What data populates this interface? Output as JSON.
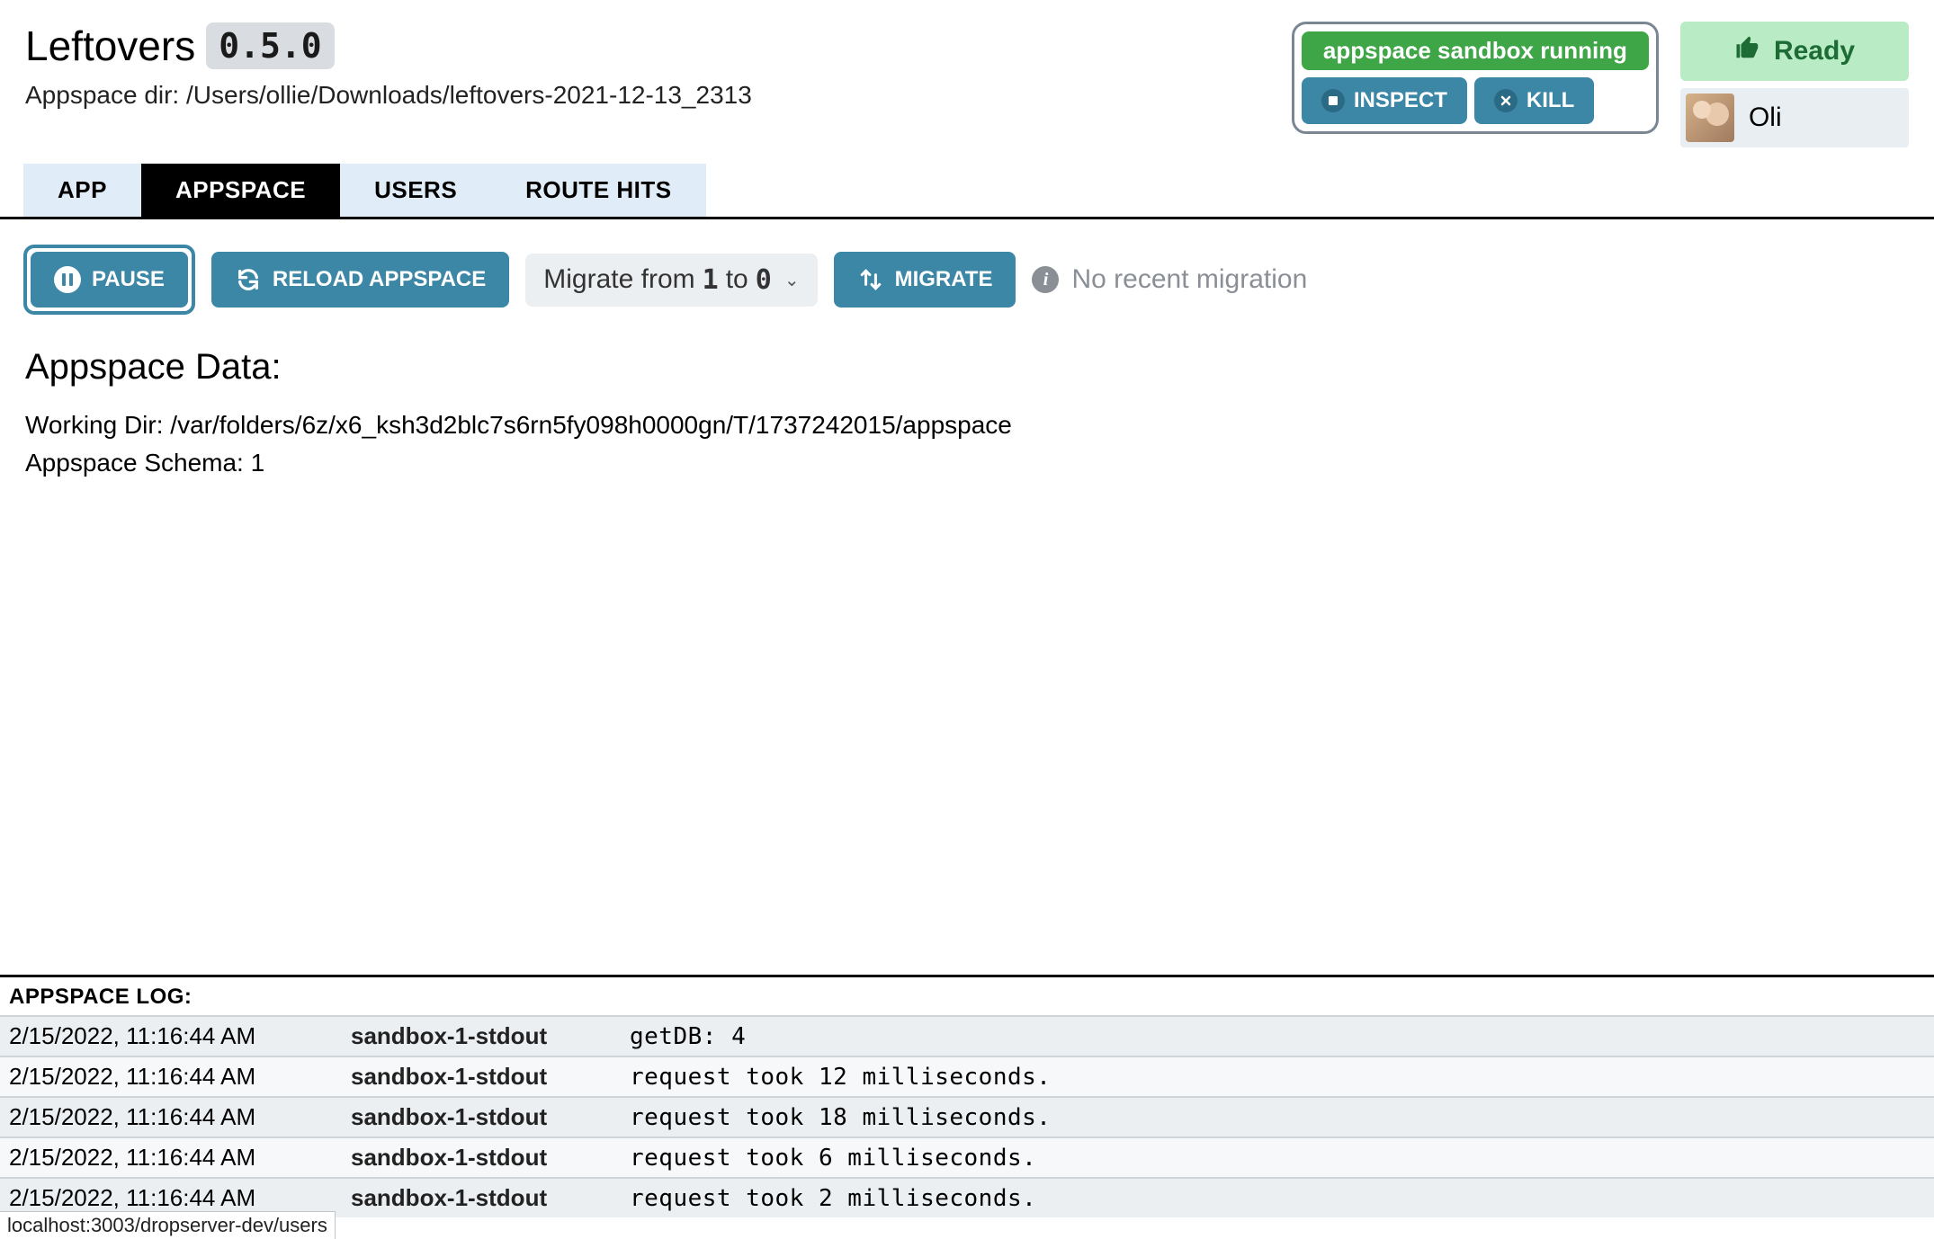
{
  "header": {
    "app_name": "Leftovers",
    "version": "0.5.0",
    "subtitle_label": "Appspace dir:",
    "subtitle_path": "/Users/ollie/Downloads/leftovers-2021-12-13_2313"
  },
  "sandbox": {
    "status": "appspace sandbox running",
    "inspect_label": "INSPECT",
    "kill_label": "KILL"
  },
  "ready": {
    "label": "Ready"
  },
  "user": {
    "name": "Oli"
  },
  "tabs": [
    {
      "id": "app",
      "label": "APP",
      "active": false
    },
    {
      "id": "appspace",
      "label": "APPSPACE",
      "active": true
    },
    {
      "id": "users",
      "label": "USERS",
      "active": false
    },
    {
      "id": "routehits",
      "label": "ROUTE HITS",
      "active": false
    }
  ],
  "toolbar": {
    "pause_label": "PAUSE",
    "reload_label": "RELOAD APPSPACE",
    "migrate_from_text": "Migrate from",
    "migrate_from_value": "1",
    "migrate_to_text": "to",
    "migrate_to_value": "0",
    "migrate_button": "MIGRATE",
    "migration_status": "No recent migration"
  },
  "content": {
    "section_title": "Appspace Data:",
    "working_dir_label": "Working Dir:",
    "working_dir_value": "/var/folders/6z/x6_ksh3d2blc7s6rn5fy098h0000gn/T/1737242015/appspace",
    "schema_label": "Appspace Schema:",
    "schema_value": "1"
  },
  "log": {
    "header": "APPSPACE LOG:",
    "rows": [
      {
        "time": "2/15/2022, 11:16:44 AM",
        "src": "sandbox-1-stdout",
        "msg": "getDB: 4"
      },
      {
        "time": "2/15/2022, 11:16:44 AM",
        "src": "sandbox-1-stdout",
        "msg": "request took 12 milliseconds."
      },
      {
        "time": "2/15/2022, 11:16:44 AM",
        "src": "sandbox-1-stdout",
        "msg": "request took 18 milliseconds."
      },
      {
        "time": "2/15/2022, 11:16:44 AM",
        "src": "sandbox-1-stdout",
        "msg": "request took 6 milliseconds."
      },
      {
        "time": "2/15/2022, 11:16:44 AM",
        "src": "sandbox-1-stdout",
        "msg": "request took 2 milliseconds."
      }
    ]
  },
  "status_url": "localhost:3003/dropserver-dev/users"
}
